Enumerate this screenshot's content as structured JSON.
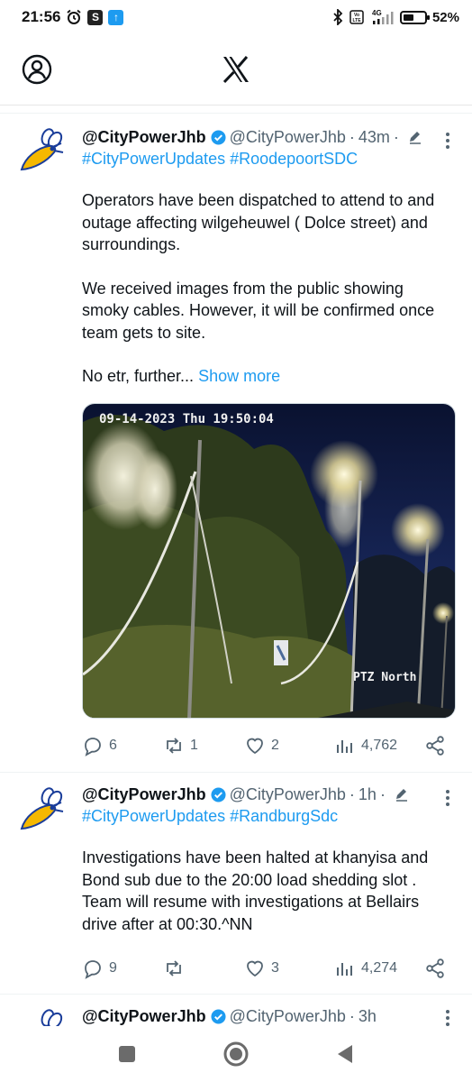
{
  "status_bar": {
    "time": "21:56",
    "left_badges": [
      "S",
      "↑"
    ],
    "network": "4G",
    "volte": "Vo LTE",
    "battery_percent": "52%",
    "battery_level": 0.52
  },
  "header": {
    "profile_icon": "person-circle-icon",
    "logo_icon": "x-logo-icon"
  },
  "tweets": [
    {
      "author": "@CityPowerJhb",
      "handle": "@CityPowerJhb",
      "time": "43m",
      "hashtags": [
        "#CityPowerUpdates",
        "#RoodepoortSDC"
      ],
      "paragraphs": [
        "Operators have been dispatched to attend to and outage affecting wilgeheuwel ( Dolce street) and surroundings.",
        "We received images from the public showing smoky cables. However, it will be confirmed once team gets to site."
      ],
      "truncated": "No etr, further...",
      "show_more": "Show more",
      "media": {
        "timestamp": "09-14-2023 Thu 19:50:04",
        "camera": "PTZ North"
      },
      "replies": "6",
      "reposts": "1",
      "likes": "2",
      "views": "4,762"
    },
    {
      "author": "@CityPowerJhb",
      "handle": "@CityPowerJhb",
      "time": "1h",
      "hashtags": [
        "#CityPowerUpdates",
        "#RandburgSdc"
      ],
      "paragraphs": [
        "Investigations have been halted at khanyisa and Bond sub  due to the 20:00 load shedding  slot . Team will resume with investigations at Bellairs drive after at 00:30.^NN"
      ],
      "replies": "9",
      "reposts": "",
      "likes": "3",
      "views": "4,274"
    },
    {
      "author": "@CityPowerJhb",
      "handle": "@CityPowerJhb",
      "time": "3h"
    }
  ],
  "colors": {
    "accent": "#1d9bf0",
    "text": "#0f1419",
    "muted": "#536471",
    "mascot_yellow": "#f5b800",
    "mascot_blue": "#1a3d9a"
  }
}
